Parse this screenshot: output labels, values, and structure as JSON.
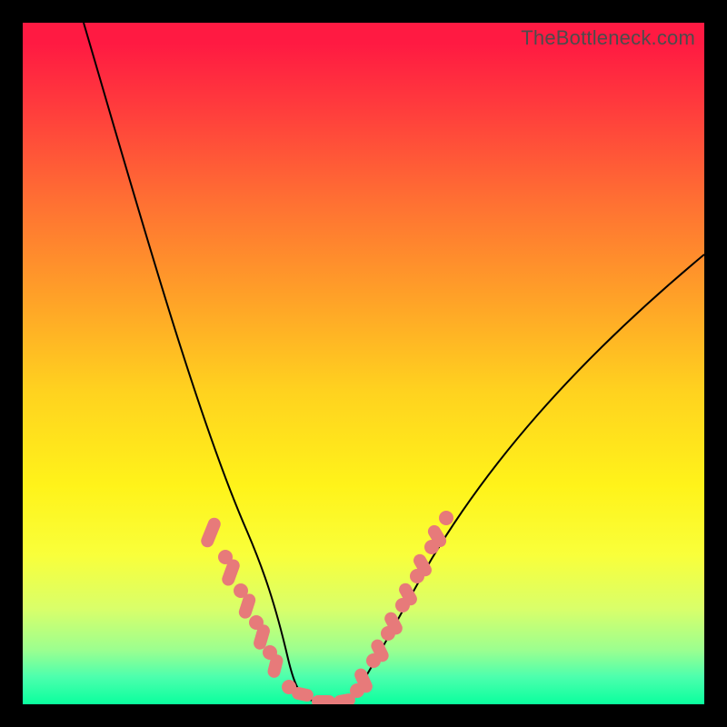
{
  "watermark": "TheBottleneck.com",
  "chart_data": {
    "type": "line",
    "title": "",
    "xlabel": "",
    "ylabel": "",
    "x_range": [
      0,
      100
    ],
    "y_range": [
      0,
      100
    ],
    "background_gradient": {
      "orientation": "vertical",
      "stops": [
        {
          "pos": 0.0,
          "color": "#ff1a42"
        },
        {
          "pos": 0.26,
          "color": "#ff6f33"
        },
        {
          "pos": 0.54,
          "color": "#ffd21f"
        },
        {
          "pos": 0.78,
          "color": "#f9ff3a"
        },
        {
          "pos": 0.92,
          "color": "#9cff8f"
        },
        {
          "pos": 1.0,
          "color": "#0aff9e"
        }
      ]
    },
    "series": [
      {
        "name": "left-branch",
        "x": [
          9,
          12,
          15,
          18,
          21,
          24,
          26,
          28,
          30,
          32,
          33.5,
          35,
          36.5,
          38
        ],
        "y": [
          100,
          89,
          78,
          68,
          58,
          48,
          40,
          33,
          26,
          19,
          14,
          9,
          5,
          1.5
        ]
      },
      {
        "name": "valley-floor",
        "x": [
          38,
          40,
          42,
          44,
          46
        ],
        "y": [
          1.5,
          0.4,
          0.2,
          0.3,
          1.2
        ]
      },
      {
        "name": "right-branch",
        "x": [
          46,
          48,
          51,
          55,
          60,
          66,
          73,
          81,
          90,
          100
        ],
        "y": [
          1.2,
          4,
          9,
          16,
          24,
          33,
          42,
          51,
          59,
          66
        ]
      }
    ],
    "annotations": {
      "left_cluster_highlight_x": [
        27.2,
        29.6,
        31.4,
        33.0,
        34.6,
        36.0
      ],
      "right_cluster_highlight_x": [
        47.0,
        48.6,
        50.2,
        51.8,
        53.4,
        55.0,
        56.6,
        58.2,
        59.8
      ],
      "valley_highlight_x": [
        37.8,
        39.4,
        41.0,
        42.6,
        44.2,
        45.8
      ]
    }
  }
}
